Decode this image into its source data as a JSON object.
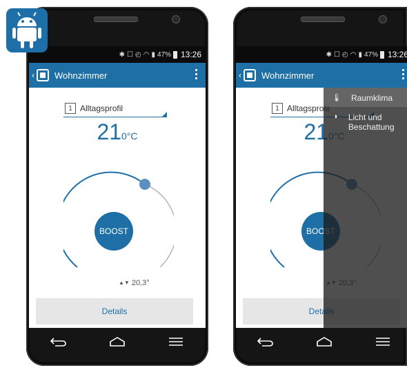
{
  "status_bar": {
    "battery": "47%",
    "time": "13:26"
  },
  "app_bar": {
    "back_glyph": "‹",
    "title": "Wohnzimmer"
  },
  "profile": {
    "number": "1",
    "name": "Alltagsprofil"
  },
  "target_temp": {
    "value": "21",
    "decimal_unit": "0°C"
  },
  "boost_label": "BOOST",
  "current_temp": {
    "arrows": "▲▼",
    "value": "20,3°"
  },
  "details_label": "Details",
  "drawer": {
    "items": [
      {
        "icon": "thermometer-icon",
        "label": "Raumklima",
        "active": true
      },
      {
        "icon": "half-sun-icon",
        "label": "Licht und Beschattung",
        "active": false
      }
    ]
  },
  "colors": {
    "accent": "#1d6fa5",
    "status_bar": "#0b0b0b",
    "badge": "#1e6fa8"
  },
  "dial": {
    "setpoint_fraction": 0.72
  }
}
